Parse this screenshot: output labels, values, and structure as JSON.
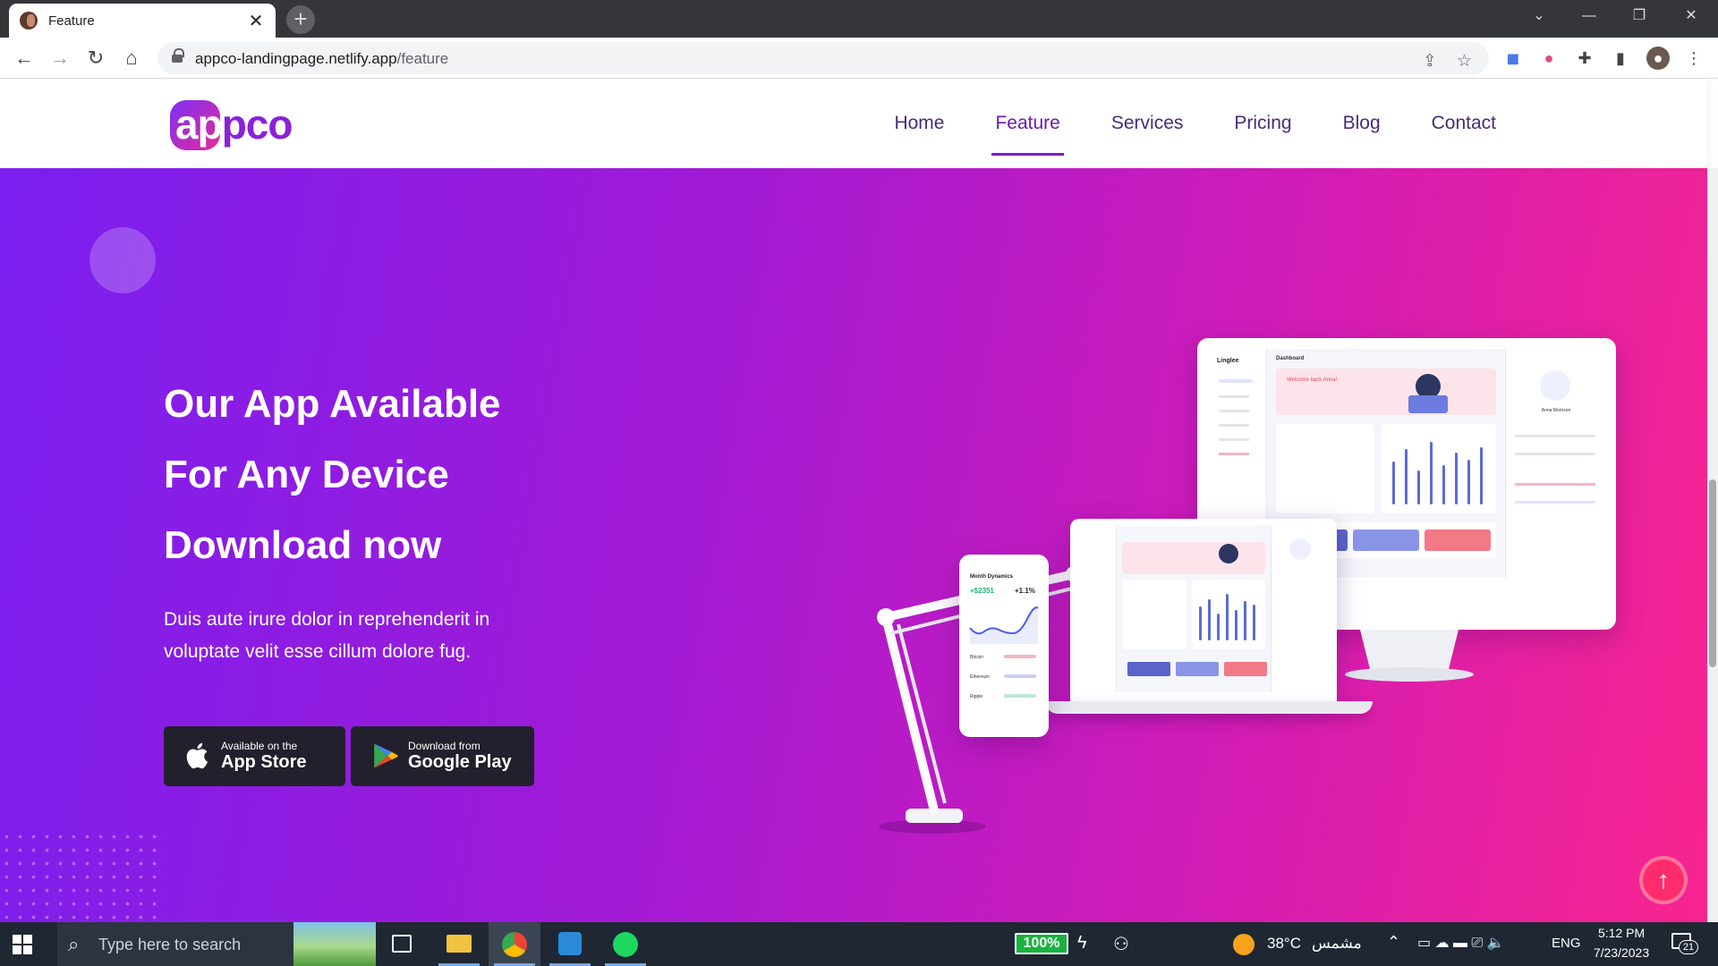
{
  "browser": {
    "tab_title": "Feature",
    "tab_close": "✕",
    "new_tab": "+",
    "url_host": "appco-landingpage.netlify.app",
    "url_path": "/feature",
    "window_controls": [
      "⌄",
      "—",
      "❐",
      "✕"
    ]
  },
  "site": {
    "logo_text_white": "ap",
    "logo_text_purple": "pco",
    "nav": [
      {
        "label": "Home",
        "active": false
      },
      {
        "label": "Feature",
        "active": true
      },
      {
        "label": "Services",
        "active": false
      },
      {
        "label": "Pricing",
        "active": false
      },
      {
        "label": "Blog",
        "active": false
      },
      {
        "label": "Contact",
        "active": false
      }
    ]
  },
  "hero": {
    "title_lines": [
      "Our App Available",
      "For Any Device",
      "Download now"
    ],
    "subtitle": "Duis aute irure dolor in reprehenderit in voluptate velit esse cillum dolore fug.",
    "app_store": {
      "small": "Available on the",
      "big": "App Store"
    },
    "google_play": {
      "small": "Download from",
      "big": "Google Play"
    },
    "back_to_top": "↑"
  },
  "mockups": {
    "monitor_app": "Linglee",
    "monitor_page": "Dashboard",
    "monitor_welcome": "Welcome back Anna!",
    "monitor_user": "Anna Morrison",
    "phone_title": "Month Dynamics",
    "phone_value": "+$2351",
    "phone_change": "+1.1%",
    "phone_rows": [
      "Bitcoin",
      "Ethereum",
      "Ripple"
    ]
  },
  "taskbar": {
    "search_placeholder": "Type here to search",
    "battery": "100%",
    "weather": "38°C",
    "weather_label": "مشمس",
    "language": "ENG",
    "time": "5:12 PM",
    "date": "7/23/2023",
    "notifications": "21"
  },
  "colors": {
    "hero_start": "#7a1ff0",
    "hero_end": "#f8258f",
    "nav_text": "#4b2a7a",
    "store_button": "#23202d",
    "back_to_top": "#ff2c6d"
  }
}
